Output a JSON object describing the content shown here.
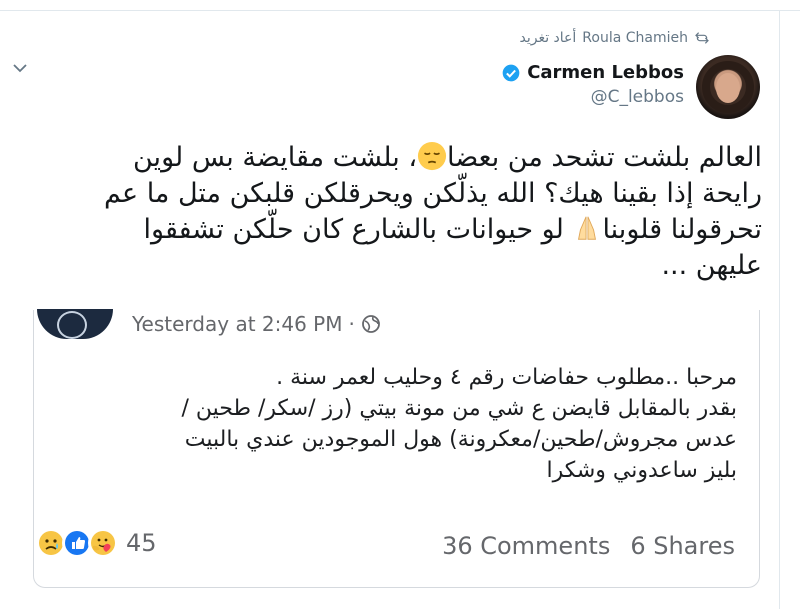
{
  "retweet": {
    "by": "Roula Chamieh",
    "label": "أعاد تغريد"
  },
  "author": {
    "name": "Carmen Lebbos",
    "handle": "@C_lebbos"
  },
  "tweet": {
    "line1a": "العالم بلشت تشحد من بعضا",
    "line1b": "، بلشت مقايضة بس لوين",
    "line2": "رايحة إذا بقينا هيك؟ الله يذلّكن ويحرقلكن قلبكن متل ما عم",
    "line3a": "تحرقولنا قلوبنا",
    "line3b": " لو حيوانات بالشارع كان حلّكن تشفقوا",
    "line4": "عليهن ..."
  },
  "embedded_post": {
    "timestamp": "Yesterday at 2:46 PM",
    "separator": "·",
    "body": [
      "مرحبا ..مطلوب حفاضات رقم ٤ وحليب لعمر سنة .",
      "بقدر بالمقابل قايضن ع شي من مونة بيتي (رز /سكر/ طحين /",
      "عدس مجروش/طحين/معكرونة) هول الموجودين عندي بالبيت",
      "بليز ساعدوني وشكرا"
    ],
    "reactions_count": "45",
    "comments": "36 Comments",
    "shares": "6 Shares"
  },
  "icons": {
    "chevron": "chevron-down-icon",
    "retweet": "retweet-icon",
    "verified": "verified-badge-icon",
    "globe": "globe-icon"
  },
  "colors": {
    "verified": "#1da1f2",
    "muted": "#657786",
    "text": "#14171a"
  }
}
